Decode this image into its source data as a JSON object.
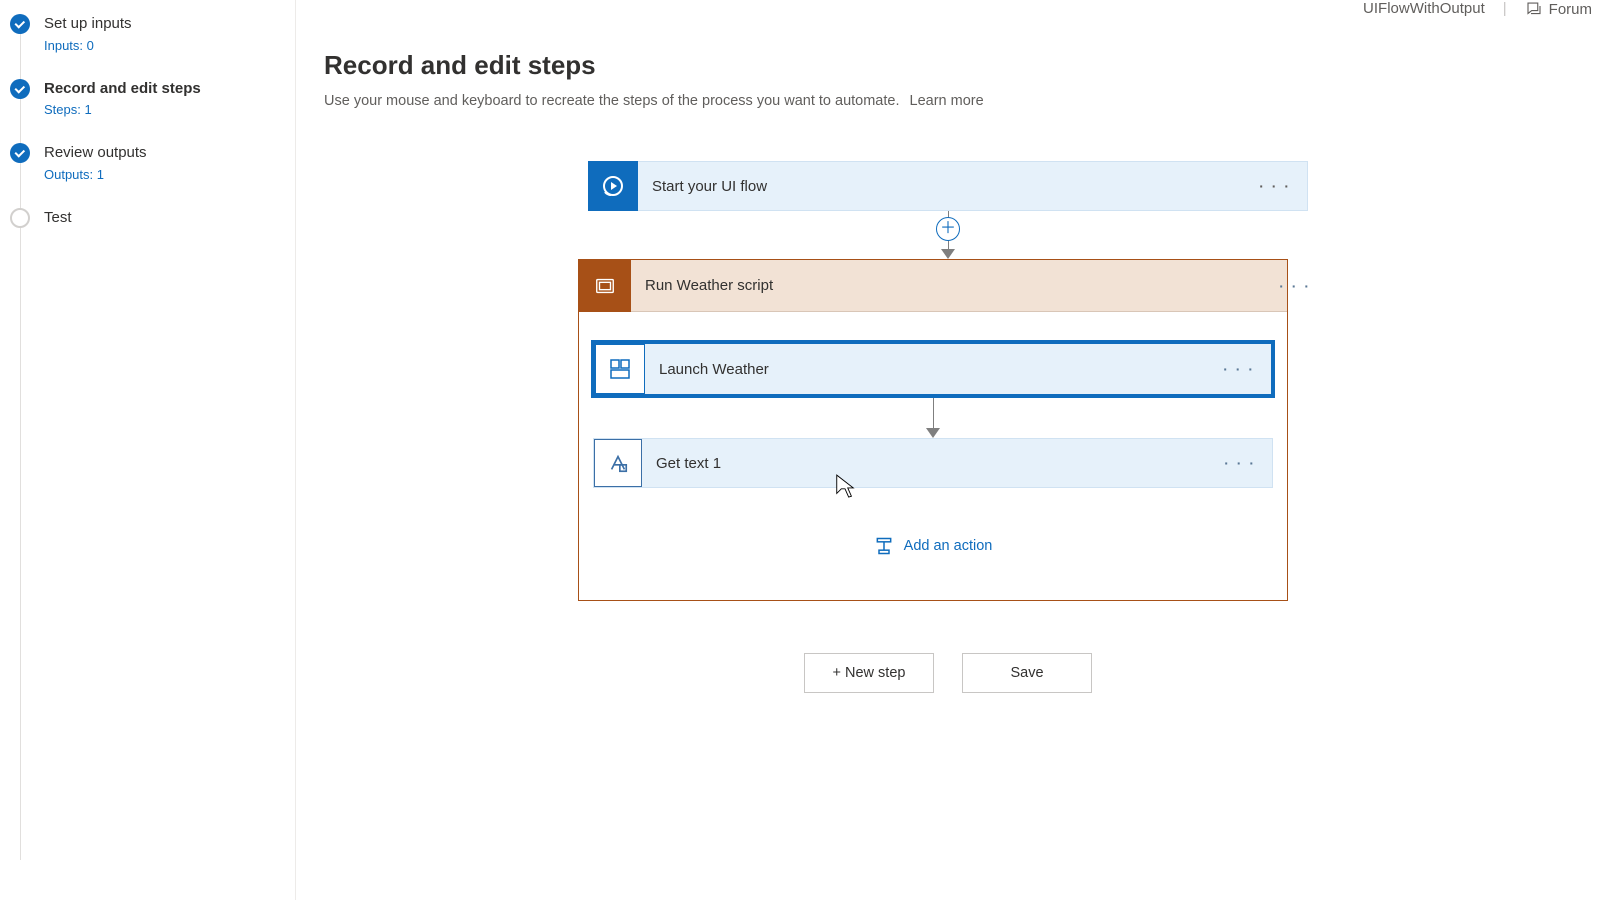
{
  "topbar": {
    "flow_name": "UIFlowWithOutput",
    "forum": "Forum"
  },
  "sidebar": {
    "steps": [
      {
        "title": "Set up inputs",
        "sub": "Inputs: 0",
        "state": "done",
        "current": false
      },
      {
        "title": "Record and edit steps",
        "sub": "Steps: 1",
        "state": "done",
        "current": true
      },
      {
        "title": "Review outputs",
        "sub": "Outputs: 1",
        "state": "done",
        "current": false
      },
      {
        "title": "Test",
        "sub": "",
        "state": "todo",
        "current": false
      }
    ]
  },
  "main": {
    "title": "Record and edit steps",
    "subtitle": "Use your mouse and keyboard to recreate the steps of the process you want to automate.",
    "learn_more": "Learn more"
  },
  "flow": {
    "start": {
      "label": "Start your UI flow"
    },
    "scope": {
      "header": "Run Weather script",
      "actions": [
        {
          "label": "Launch Weather",
          "kind": "launch",
          "selected": true
        },
        {
          "label": "Get text 1",
          "kind": "gettext",
          "selected": false
        }
      ],
      "add_action": "Add an action"
    }
  },
  "buttons": {
    "new_step": "+ New step",
    "save": "Save"
  },
  "glyphs": {
    "ellipsis": "· · ·",
    "plus": "＋"
  }
}
